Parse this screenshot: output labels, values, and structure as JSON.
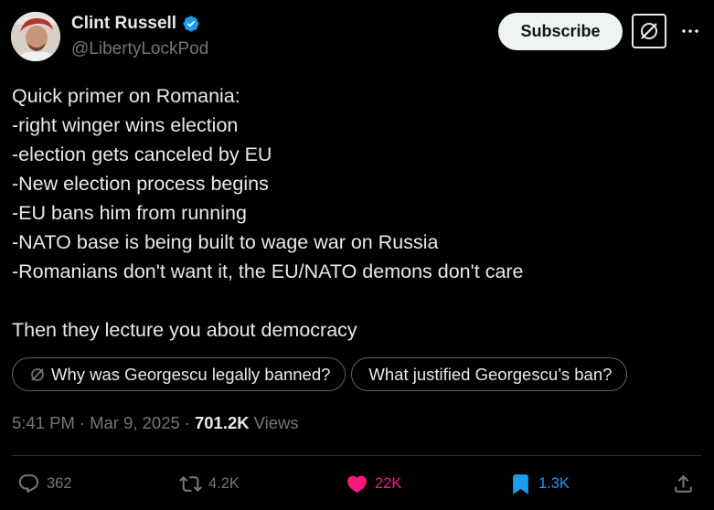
{
  "author": {
    "display_name": "Clint Russell",
    "handle": "@LibertyLockPod",
    "verified": true
  },
  "header": {
    "subscribe_label": "Subscribe"
  },
  "tweet": {
    "lines": [
      "Quick primer on Romania:",
      "-right winger wins election",
      "-election gets canceled by EU",
      "-New election process begins",
      "-EU bans him from running",
      "-NATO base is being built to wage war on Russia",
      "-Romanians don't want it, the EU/NATO demons don't care",
      "",
      "Then they lecture you about democracy"
    ]
  },
  "grok_prompts": [
    "Why was Georgescu legally banned?",
    "What justified Georgescu’s ban?"
  ],
  "meta": {
    "time": "5:41 PM",
    "separator": "·",
    "date": "Mar 9, 2025",
    "views_count": "701.2K",
    "views_label": "Views"
  },
  "actions": {
    "replies": "362",
    "reposts": "4.2K",
    "likes": "22K",
    "bookmarks": "1.3K"
  },
  "colors": {
    "background": "#000000",
    "text": "#e7e9ea",
    "muted": "#71767b",
    "like": "#f91880",
    "bookmark": "#1d9bf0",
    "verified": "#1d9bf0"
  },
  "icons": {
    "verified": "verified-badge-icon",
    "grok": "grok-icon",
    "more": "more-icon",
    "reply": "reply-icon",
    "repost": "repost-icon",
    "like": "heart-icon",
    "bookmark": "bookmark-icon",
    "share": "share-icon"
  }
}
